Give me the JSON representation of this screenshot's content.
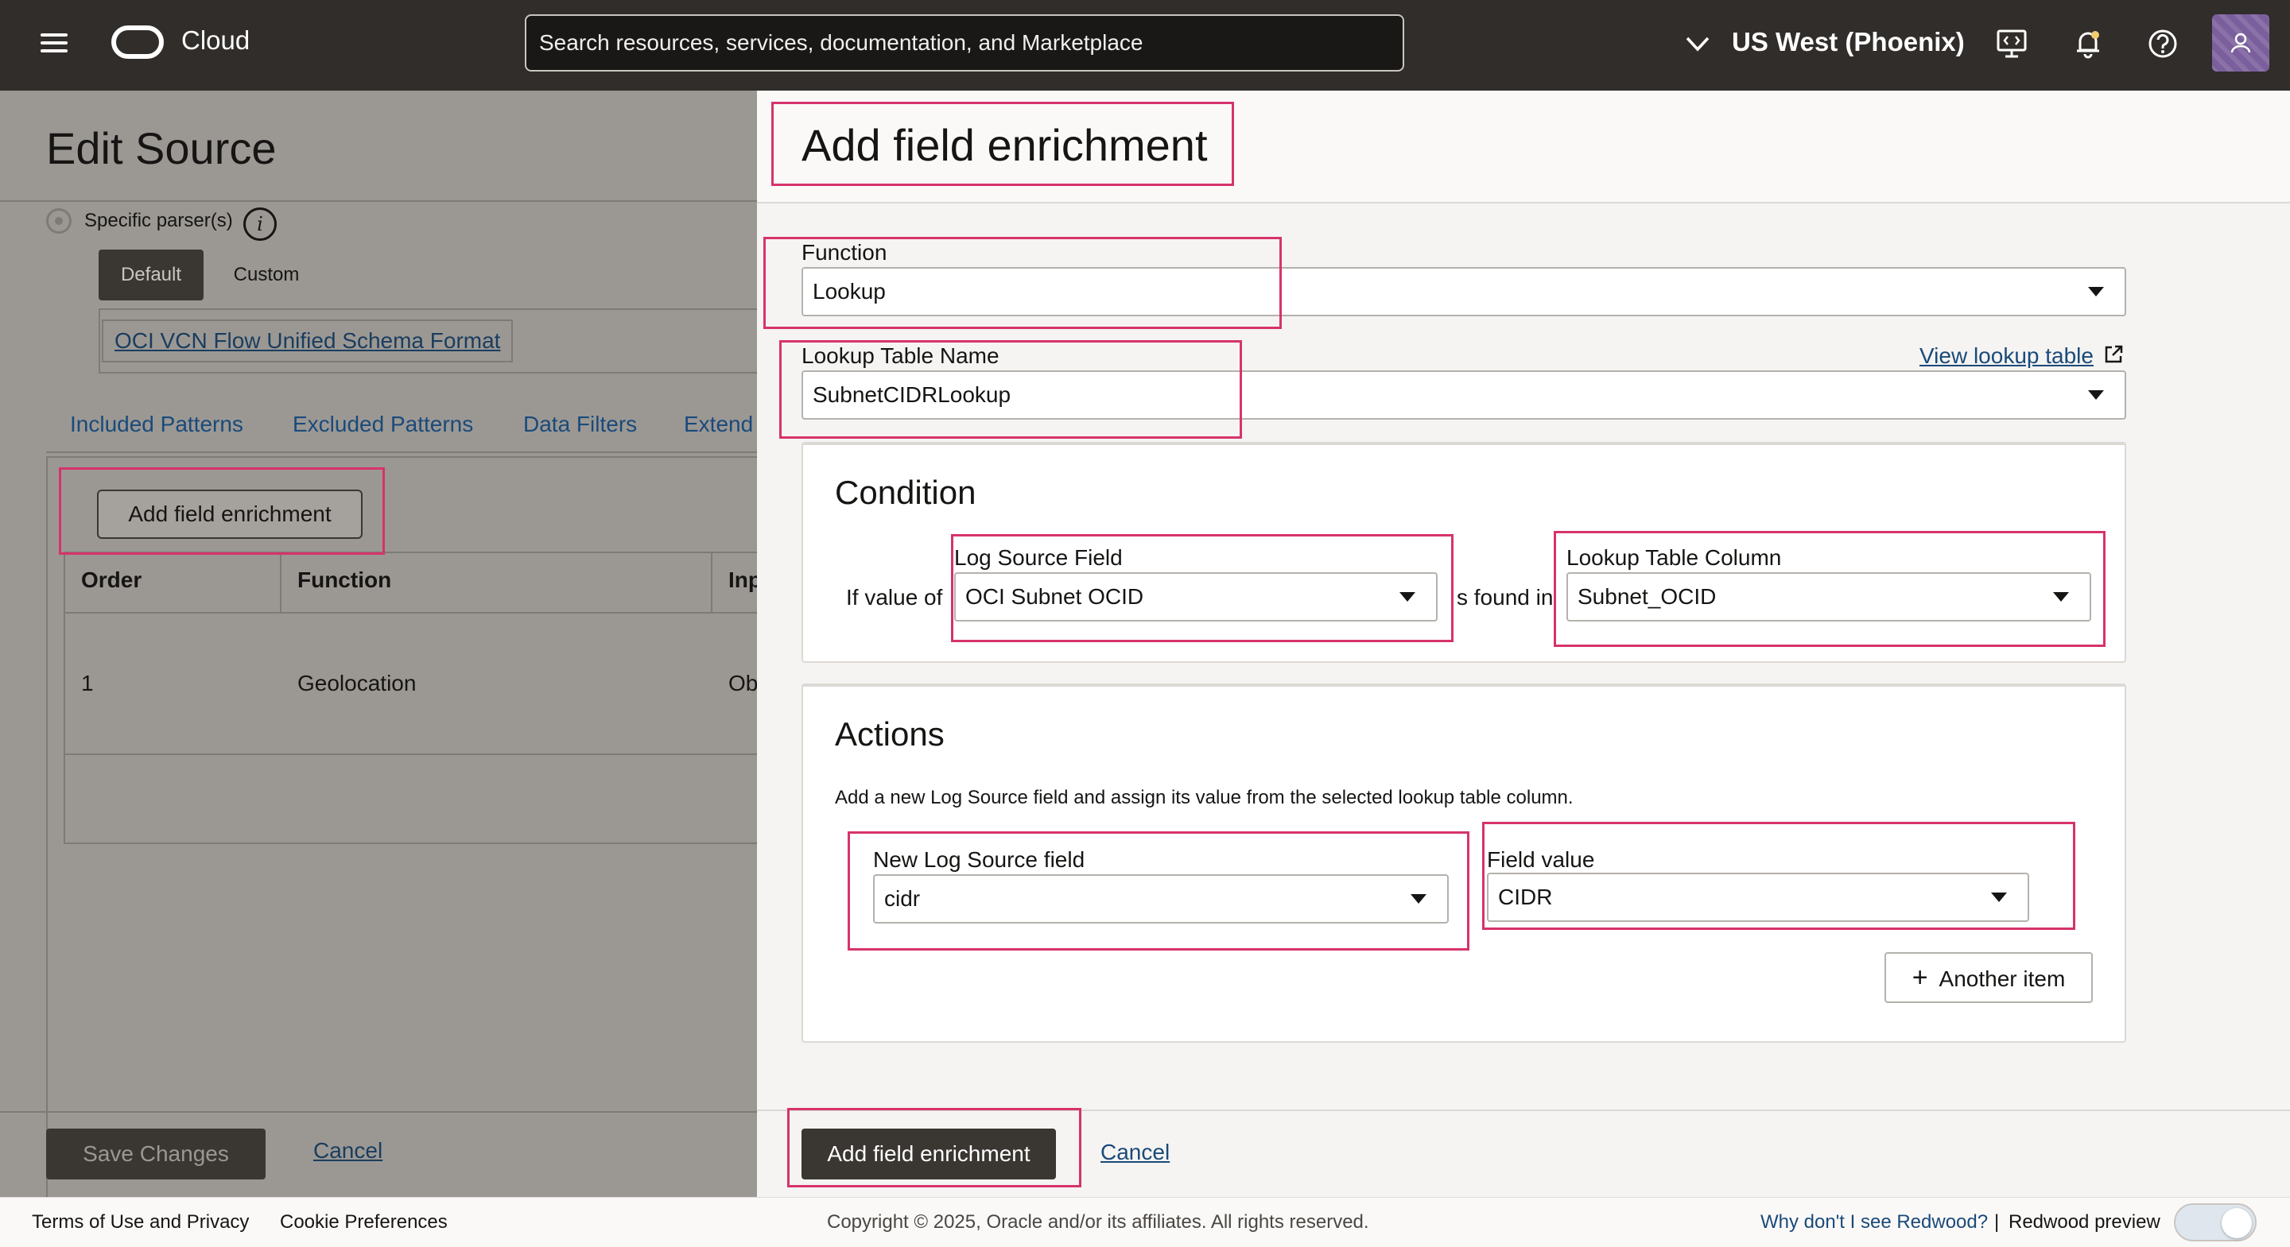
{
  "topbar": {
    "brand": "Cloud",
    "search_placeholder": "Search resources, services, documentation, and Marketplace",
    "region": "US West (Phoenix)",
    "icons": [
      "menu-icon",
      "oracle-logo-icon",
      "chevron-down-icon",
      "developer-tools-icon",
      "bell-icon",
      "help-icon",
      "avatar-icon"
    ]
  },
  "left_panel": {
    "title": "Edit Source",
    "parser_option": "Specific parser(s)",
    "segment": [
      "Default",
      "Custom"
    ],
    "parser_link": "OCI VCN Flow Unified Schema Format",
    "tabs": [
      "Included Patterns",
      "Excluded Patterns",
      "Data Filters",
      "Extend"
    ],
    "add_button": "Add field enrichment",
    "table": {
      "headers": [
        "Order",
        "Function",
        "Inp"
      ],
      "rows": [
        [
          "1",
          "Geolocation",
          "Ob"
        ]
      ]
    },
    "save": "Save Changes",
    "cancel": "Cancel"
  },
  "drawer": {
    "title": "Add field enrichment",
    "function_label": "Function",
    "function_value": "Lookup",
    "lookup_label": "Lookup Table Name",
    "lookup_value": "SubnetCIDRLookup",
    "view_lookup": "View lookup table",
    "condition": {
      "title": "Condition",
      "if_value_of": "If value of",
      "log_source_field_label": "Log Source Field",
      "log_source_field_value": "OCI Subnet OCID",
      "is_found_in": "s found in",
      "lookup_column_label": "Lookup Table Column",
      "lookup_column_value": "Subnet_OCID"
    },
    "actions": {
      "title": "Actions",
      "description": "Add a new Log Source field and assign its value from the selected lookup table column.",
      "new_field_label": "New Log Source field",
      "new_field_value": "cidr",
      "field_value_label": "Field value",
      "field_value_value": "CIDR",
      "another_item": "Another item"
    },
    "submit": "Add field enrichment",
    "cancel": "Cancel"
  },
  "footer": {
    "terms": "Terms of Use and Privacy",
    "cookies": "Cookie Preferences",
    "copyright": "Copyright © 2025, Oracle and/or its affiliates. All rights reserved.",
    "redwood_link": "Why don't I see Redwood?",
    "separator": "|",
    "redwood_preview": "Redwood preview"
  },
  "colors": {
    "topbar": "#312d2a",
    "highlight": "#d6336c",
    "primary_button": "#3a3632",
    "link": "#1a4a7a"
  }
}
